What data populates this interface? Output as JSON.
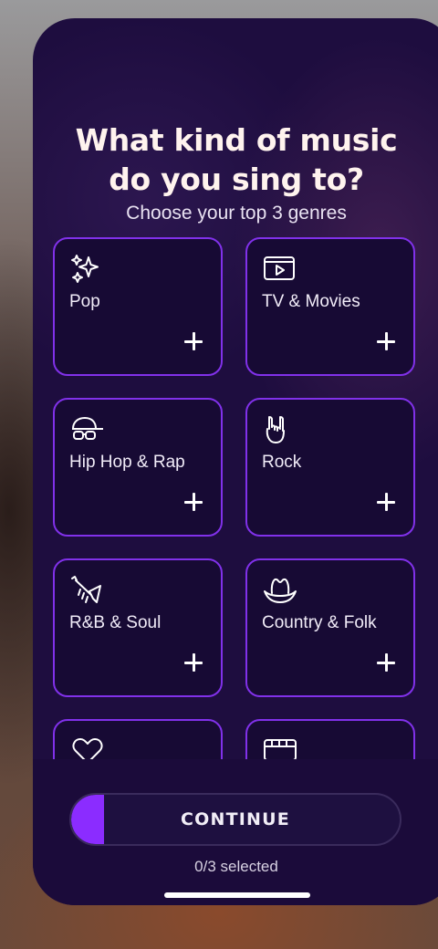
{
  "title_line1": "What kind of music",
  "title_line2": "do you sing to?",
  "subtitle": "Choose your top 3 genres",
  "genres": [
    {
      "label": "Pop",
      "icon": "sparkles-icon"
    },
    {
      "label": "TV & Movies",
      "icon": "video-play-icon"
    },
    {
      "label": "Hip Hop & Rap",
      "icon": "cap-sunglasses-icon"
    },
    {
      "label": "Rock",
      "icon": "rock-hand-icon"
    },
    {
      "label": "R&B & Soul",
      "icon": "trumpet-icon"
    },
    {
      "label": "Country & Folk",
      "icon": "cowboy-hat-icon"
    },
    {
      "label": "",
      "icon": "heart-icon"
    },
    {
      "label": "",
      "icon": "keyboard-icon"
    }
  ],
  "continue_label": "CONTINUE",
  "selection_progress": 0,
  "selected_count_text": "0/3 selected",
  "colors": {
    "card_background": "#1e0d3f",
    "tile_background": "#170a34",
    "tile_border": "#8131ea",
    "accent_fill": "#8b2cff",
    "title_text": "#fff3ee"
  }
}
